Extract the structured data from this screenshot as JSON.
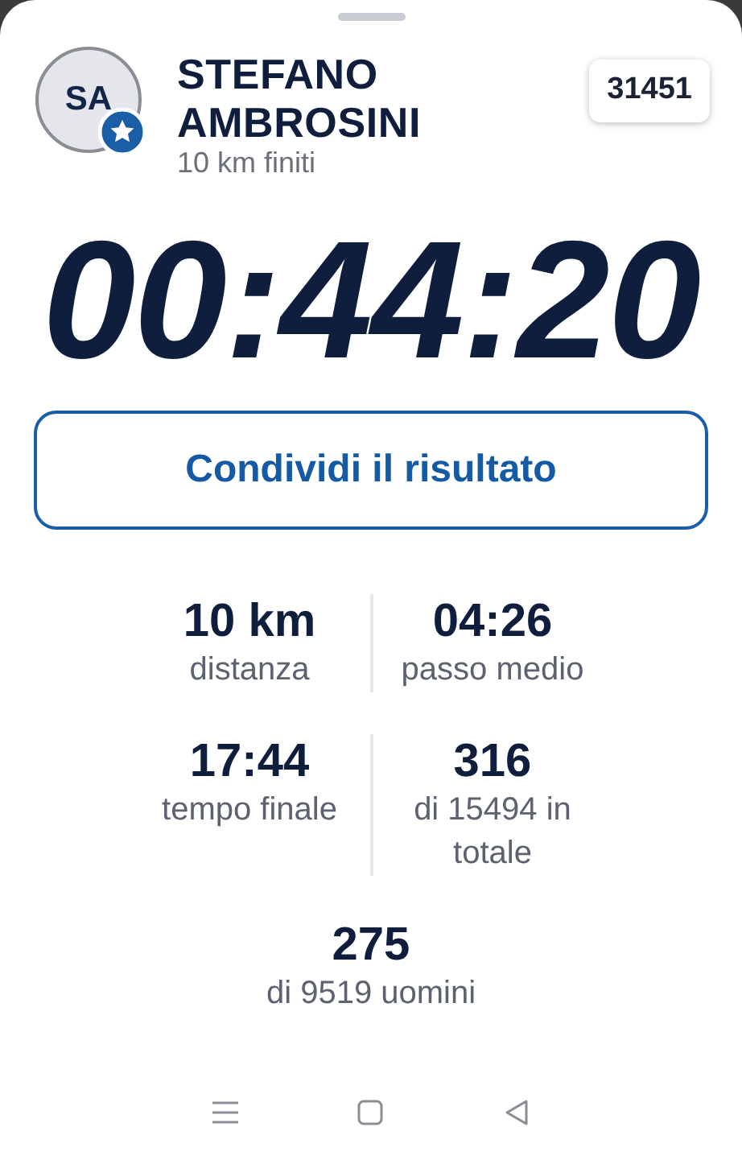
{
  "runner": {
    "initials": "SA",
    "name": "STEFANO AMBROSINI",
    "subtitle": "10 km finiti",
    "bib": "31451"
  },
  "finish_time": "00:44:20",
  "share_button": "Condividi il risultato",
  "stat_rows": [
    {
      "stats": [
        {
          "value": "10 km",
          "label": "distanza"
        },
        {
          "value": "04:26",
          "label": "passo medio"
        }
      ]
    },
    {
      "stats": [
        {
          "value": "17:44",
          "label": "tempo finale"
        },
        {
          "value": "316",
          "label": "di 15494 in totale"
        }
      ]
    },
    {
      "stats": [
        {
          "value": "275",
          "label": "di 9519 uomini"
        }
      ]
    }
  ]
}
